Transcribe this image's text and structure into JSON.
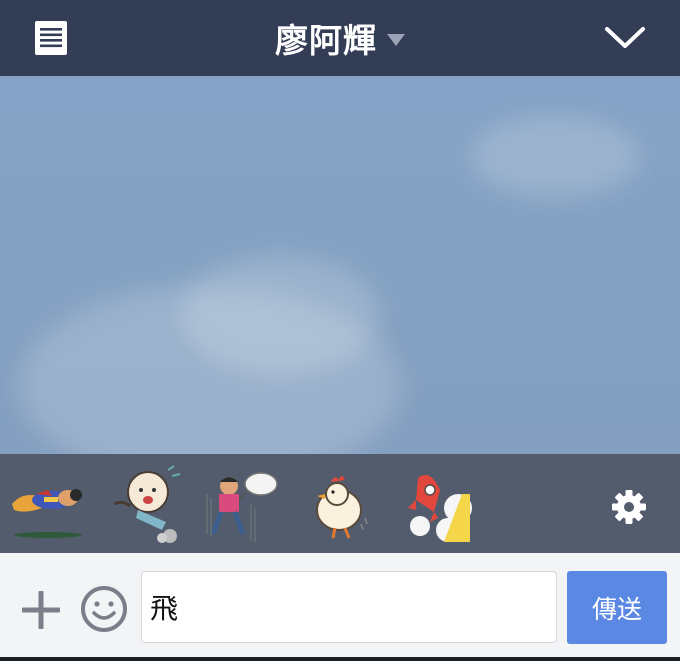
{
  "header": {
    "title": "廖阿輝",
    "bg_color": "#333d56"
  },
  "chat": {
    "bg_color": "#85a3c6"
  },
  "stickers": {
    "items": [
      {
        "name": "flying-hero-sticker"
      },
      {
        "name": "bald-man-kick-sticker"
      },
      {
        "name": "running-net-sticker"
      },
      {
        "name": "chicken-sticker"
      },
      {
        "name": "rocket-sticker"
      }
    ],
    "settings_icon": "gear-icon",
    "bg_color": "#525c6d"
  },
  "composer": {
    "input_value": "飛",
    "send_label": "傳送",
    "send_color": "#5b88e3",
    "add_icon": "plus-icon",
    "emoji_icon": "smiley-icon"
  }
}
